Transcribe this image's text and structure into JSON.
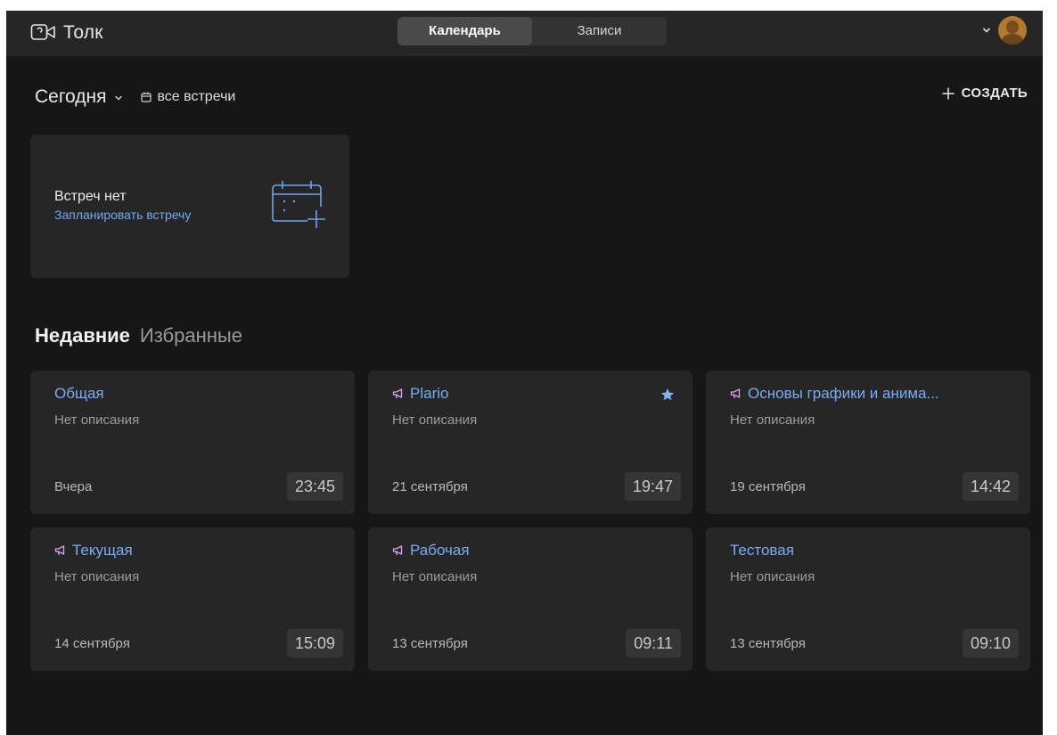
{
  "app": {
    "name": "Толк"
  },
  "topbar": {
    "tabs": [
      {
        "label": "Календарь",
        "active": true
      },
      {
        "label": "Записи",
        "active": false
      }
    ]
  },
  "today": {
    "title": "Сегодня",
    "all_meetings_label": "все встречи",
    "create_label": "СОЗДАТЬ",
    "empty": {
      "title": "Встреч нет",
      "link": "Запланировать встречу"
    }
  },
  "sections": {
    "tabs": [
      {
        "label": "Недавние",
        "active": true
      },
      {
        "label": "Избранные",
        "active": false
      }
    ]
  },
  "rooms": [
    {
      "title": "Общая",
      "description": "Нет описания",
      "date": "Вчера",
      "time": "23:45",
      "broadcast": false,
      "favorite": false
    },
    {
      "title": "Plario",
      "description": "Нет описания",
      "date": "21 сентября",
      "time": "19:47",
      "broadcast": true,
      "favorite": true
    },
    {
      "title": "Основы графики и анима...",
      "description": "Нет описания",
      "date": "19 сентября",
      "time": "14:42",
      "broadcast": true,
      "favorite": false
    },
    {
      "title": "Текущая",
      "description": "Нет описания",
      "date": "14 сентября",
      "time": "15:09",
      "broadcast": true,
      "favorite": false
    },
    {
      "title": "Рабочая",
      "description": "Нет описания",
      "date": "13 сентября",
      "time": "09:11",
      "broadcast": true,
      "favorite": false
    },
    {
      "title": "Тестовая",
      "description": "Нет описания",
      "date": "13 сентября",
      "time": "09:10",
      "broadcast": false,
      "favorite": false
    }
  ],
  "colors": {
    "accent_link": "#72a7f2",
    "title_link": "#76aef5",
    "broadcast_icon": "#d6a4f0",
    "background": "#161616",
    "card": "#262626"
  },
  "icons": {
    "logo": "video-camera-icon",
    "broadcast": "megaphone-icon",
    "favorite": "star-icon",
    "create": "plus-icon",
    "calendar": "calendar-icon"
  }
}
